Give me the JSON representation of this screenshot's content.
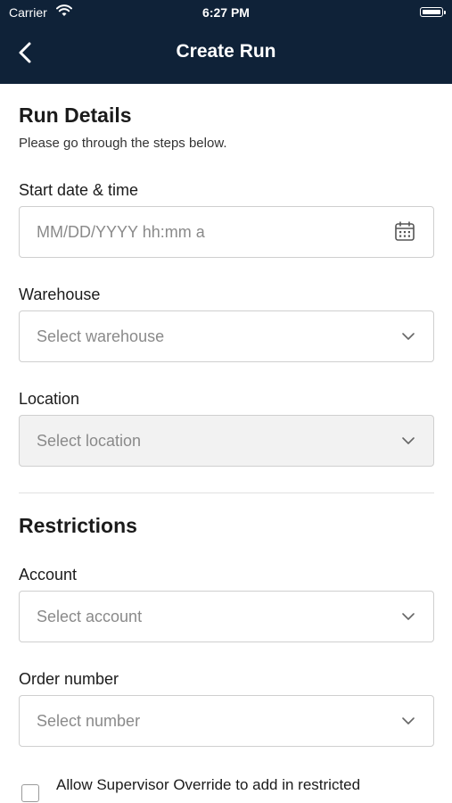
{
  "status_bar": {
    "carrier": "Carrier",
    "time": "6:27 PM"
  },
  "nav": {
    "title": "Create Run",
    "back_icon": "chevron-left-icon"
  },
  "run_details": {
    "title": "Run Details",
    "subtitle": "Please go through the steps below.",
    "start": {
      "label": "Start date & time",
      "placeholder": "MM/DD/YYYY hh:mm a",
      "icon": "calendar-icon"
    },
    "warehouse": {
      "label": "Warehouse",
      "placeholder": "Select warehouse",
      "icon": "chevron-down-icon"
    },
    "location": {
      "label": "Location",
      "placeholder": "Select location",
      "icon": "chevron-down-icon",
      "disabled": true
    }
  },
  "restrictions": {
    "title": "Restrictions",
    "account": {
      "label": "Account",
      "placeholder": "Select account",
      "icon": "chevron-down-icon"
    },
    "order_number": {
      "label": "Order number",
      "placeholder": "Select number",
      "icon": "chevron-down-icon"
    },
    "supervisor_override": {
      "label": "Allow Supervisor Override to add in restricted",
      "checked": false
    }
  },
  "colors": {
    "header_bg": "#0f2238",
    "field_border": "#cfcfcf",
    "placeholder": "#8a8a8a",
    "disabled_bg": "#f2f2f2"
  }
}
